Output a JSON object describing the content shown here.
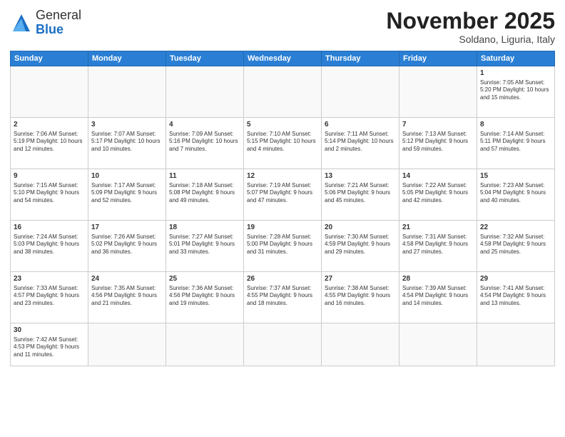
{
  "header": {
    "logo_general": "General",
    "logo_blue": "Blue",
    "month_title": "November 2025",
    "subtitle": "Soldano, Liguria, Italy"
  },
  "weekdays": [
    "Sunday",
    "Monday",
    "Tuesday",
    "Wednesday",
    "Thursday",
    "Friday",
    "Saturday"
  ],
  "weeks": [
    [
      {
        "day": "",
        "info": ""
      },
      {
        "day": "",
        "info": ""
      },
      {
        "day": "",
        "info": ""
      },
      {
        "day": "",
        "info": ""
      },
      {
        "day": "",
        "info": ""
      },
      {
        "day": "",
        "info": ""
      },
      {
        "day": "1",
        "info": "Sunrise: 7:05 AM\nSunset: 5:20 PM\nDaylight: 10 hours\nand 15 minutes."
      }
    ],
    [
      {
        "day": "2",
        "info": "Sunrise: 7:06 AM\nSunset: 5:19 PM\nDaylight: 10 hours\nand 12 minutes."
      },
      {
        "day": "3",
        "info": "Sunrise: 7:07 AM\nSunset: 5:17 PM\nDaylight: 10 hours\nand 10 minutes."
      },
      {
        "day": "4",
        "info": "Sunrise: 7:09 AM\nSunset: 5:16 PM\nDaylight: 10 hours\nand 7 minutes."
      },
      {
        "day": "5",
        "info": "Sunrise: 7:10 AM\nSunset: 5:15 PM\nDaylight: 10 hours\nand 4 minutes."
      },
      {
        "day": "6",
        "info": "Sunrise: 7:11 AM\nSunset: 5:14 PM\nDaylight: 10 hours\nand 2 minutes."
      },
      {
        "day": "7",
        "info": "Sunrise: 7:13 AM\nSunset: 5:12 PM\nDaylight: 9 hours\nand 59 minutes."
      },
      {
        "day": "8",
        "info": "Sunrise: 7:14 AM\nSunset: 5:11 PM\nDaylight: 9 hours\nand 57 minutes."
      }
    ],
    [
      {
        "day": "9",
        "info": "Sunrise: 7:15 AM\nSunset: 5:10 PM\nDaylight: 9 hours\nand 54 minutes."
      },
      {
        "day": "10",
        "info": "Sunrise: 7:17 AM\nSunset: 5:09 PM\nDaylight: 9 hours\nand 52 minutes."
      },
      {
        "day": "11",
        "info": "Sunrise: 7:18 AM\nSunset: 5:08 PM\nDaylight: 9 hours\nand 49 minutes."
      },
      {
        "day": "12",
        "info": "Sunrise: 7:19 AM\nSunset: 5:07 PM\nDaylight: 9 hours\nand 47 minutes."
      },
      {
        "day": "13",
        "info": "Sunrise: 7:21 AM\nSunset: 5:06 PM\nDaylight: 9 hours\nand 45 minutes."
      },
      {
        "day": "14",
        "info": "Sunrise: 7:22 AM\nSunset: 5:05 PM\nDaylight: 9 hours\nand 42 minutes."
      },
      {
        "day": "15",
        "info": "Sunrise: 7:23 AM\nSunset: 5:04 PM\nDaylight: 9 hours\nand 40 minutes."
      }
    ],
    [
      {
        "day": "16",
        "info": "Sunrise: 7:24 AM\nSunset: 5:03 PM\nDaylight: 9 hours\nand 38 minutes."
      },
      {
        "day": "17",
        "info": "Sunrise: 7:26 AM\nSunset: 5:02 PM\nDaylight: 9 hours\nand 36 minutes."
      },
      {
        "day": "18",
        "info": "Sunrise: 7:27 AM\nSunset: 5:01 PM\nDaylight: 9 hours\nand 33 minutes."
      },
      {
        "day": "19",
        "info": "Sunrise: 7:28 AM\nSunset: 5:00 PM\nDaylight: 9 hours\nand 31 minutes."
      },
      {
        "day": "20",
        "info": "Sunrise: 7:30 AM\nSunset: 4:59 PM\nDaylight: 9 hours\nand 29 minutes."
      },
      {
        "day": "21",
        "info": "Sunrise: 7:31 AM\nSunset: 4:58 PM\nDaylight: 9 hours\nand 27 minutes."
      },
      {
        "day": "22",
        "info": "Sunrise: 7:32 AM\nSunset: 4:58 PM\nDaylight: 9 hours\nand 25 minutes."
      }
    ],
    [
      {
        "day": "23",
        "info": "Sunrise: 7:33 AM\nSunset: 4:57 PM\nDaylight: 9 hours\nand 23 minutes."
      },
      {
        "day": "24",
        "info": "Sunrise: 7:35 AM\nSunset: 4:56 PM\nDaylight: 9 hours\nand 21 minutes."
      },
      {
        "day": "25",
        "info": "Sunrise: 7:36 AM\nSunset: 4:56 PM\nDaylight: 9 hours\nand 19 minutes."
      },
      {
        "day": "26",
        "info": "Sunrise: 7:37 AM\nSunset: 4:55 PM\nDaylight: 9 hours\nand 18 minutes."
      },
      {
        "day": "27",
        "info": "Sunrise: 7:38 AM\nSunset: 4:55 PM\nDaylight: 9 hours\nand 16 minutes."
      },
      {
        "day": "28",
        "info": "Sunrise: 7:39 AM\nSunset: 4:54 PM\nDaylight: 9 hours\nand 14 minutes."
      },
      {
        "day": "29",
        "info": "Sunrise: 7:41 AM\nSunset: 4:54 PM\nDaylight: 9 hours\nand 13 minutes."
      }
    ],
    [
      {
        "day": "30",
        "info": "Sunrise: 7:42 AM\nSunset: 4:53 PM\nDaylight: 9 hours\nand 11 minutes."
      },
      {
        "day": "",
        "info": ""
      },
      {
        "day": "",
        "info": ""
      },
      {
        "day": "",
        "info": ""
      },
      {
        "day": "",
        "info": ""
      },
      {
        "day": "",
        "info": ""
      },
      {
        "day": "",
        "info": ""
      }
    ]
  ]
}
